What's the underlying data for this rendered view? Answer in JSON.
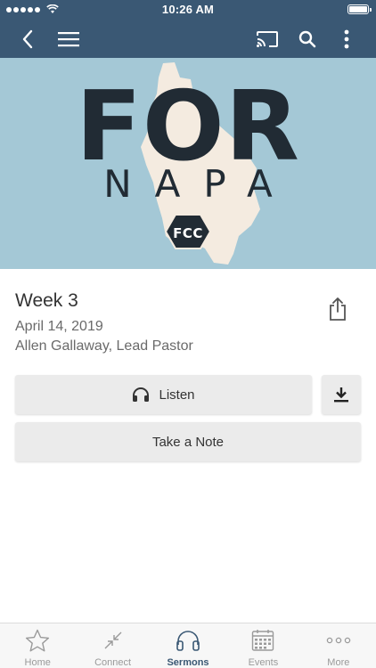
{
  "status_bar": {
    "time": "10:26 AM"
  },
  "nav": {
    "icons": [
      "back-arrow-icon",
      "hamburger-menu-icon",
      "cast-icon",
      "search-icon",
      "more-vertical-icon"
    ]
  },
  "hero": {
    "title": "FOR",
    "subtitle": "NAPA",
    "logo_text": "FCC",
    "colors": {
      "background": "#a4c8d6",
      "shape": "#f4ebe0",
      "text": "#212b34"
    }
  },
  "sermon": {
    "title": "Week 3",
    "date": "April 14, 2019",
    "speaker": "Allen Gallaway, Lead Pastor"
  },
  "actions": {
    "listen_label": "Listen",
    "note_label": "Take a Note"
  },
  "tabs": [
    {
      "label": "Home",
      "icon": "star-icon",
      "active": false
    },
    {
      "label": "Connect",
      "icon": "connect-icon",
      "active": false
    },
    {
      "label": "Sermons",
      "icon": "headphones-icon",
      "active": true
    },
    {
      "label": "Events",
      "icon": "calendar-icon",
      "active": false
    },
    {
      "label": "More",
      "icon": "dots-icon",
      "active": false
    }
  ],
  "theme": {
    "primary": "#3a5874",
    "button_bg": "#ebebeb",
    "inactive_tab": "#9a9a9a"
  }
}
